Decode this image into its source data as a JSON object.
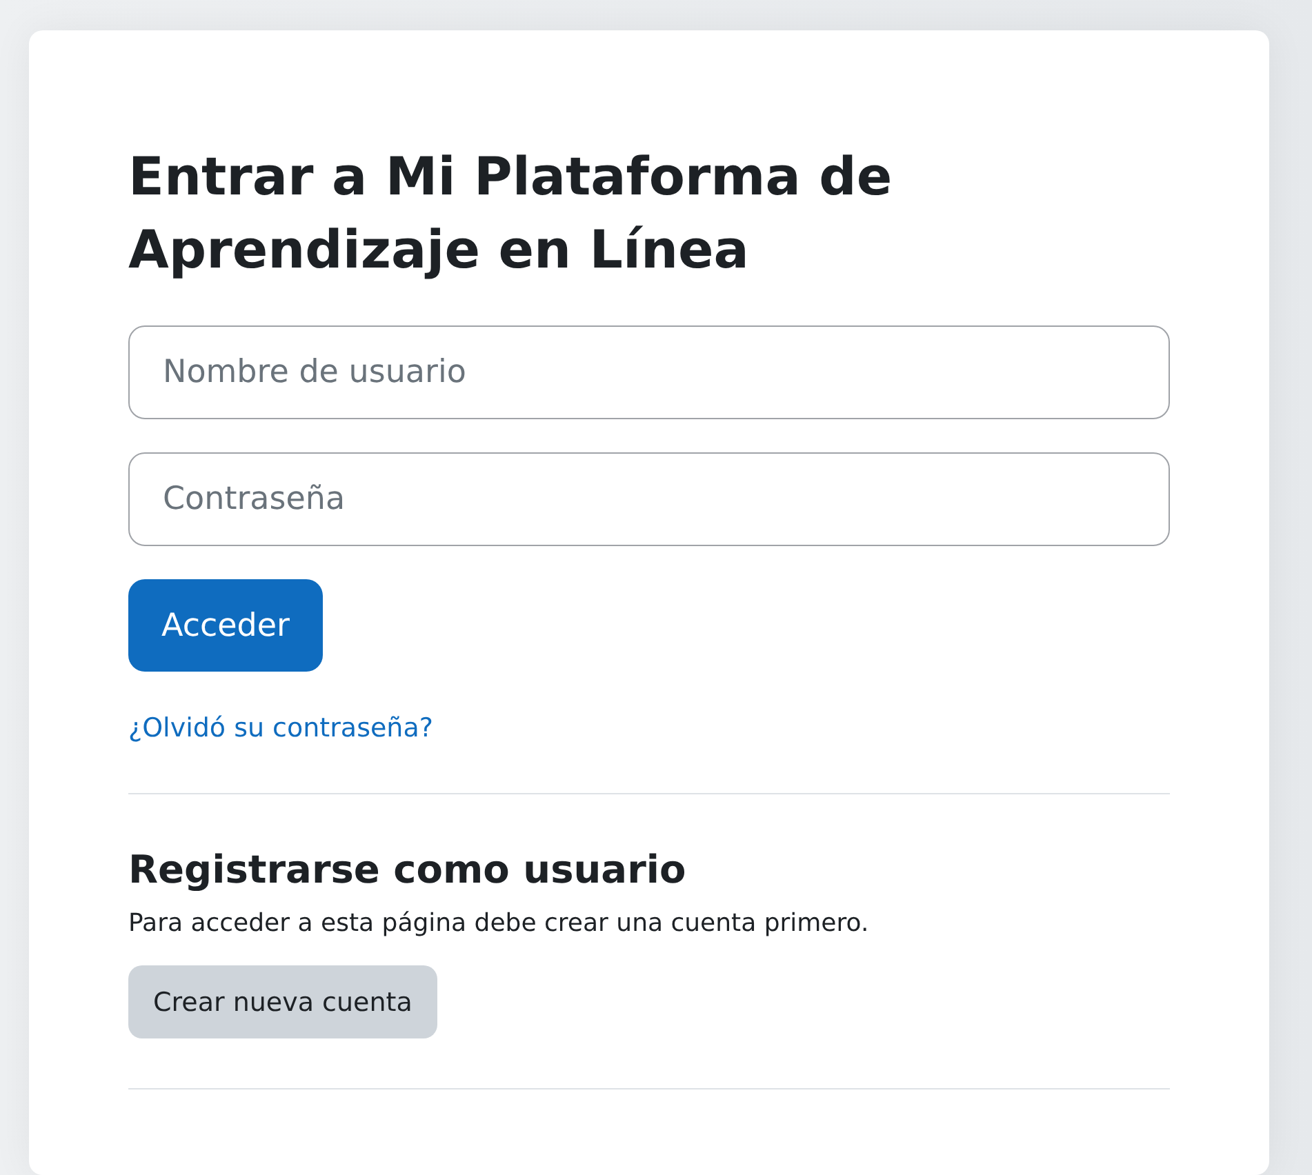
{
  "login": {
    "title": "Entrar a Mi Plataforma de Aprendizaje en Línea",
    "username": {
      "placeholder": "Nombre de usuario"
    },
    "password": {
      "placeholder": "Contraseña"
    },
    "submit": "Acceder",
    "forgot_link": "¿Olvidó su contraseña?"
  },
  "signup": {
    "title": "Registrarse como usuario",
    "text": "Para acceder a esta página debe crear una cuenta primero.",
    "button": "Crear nueva cuenta"
  }
}
